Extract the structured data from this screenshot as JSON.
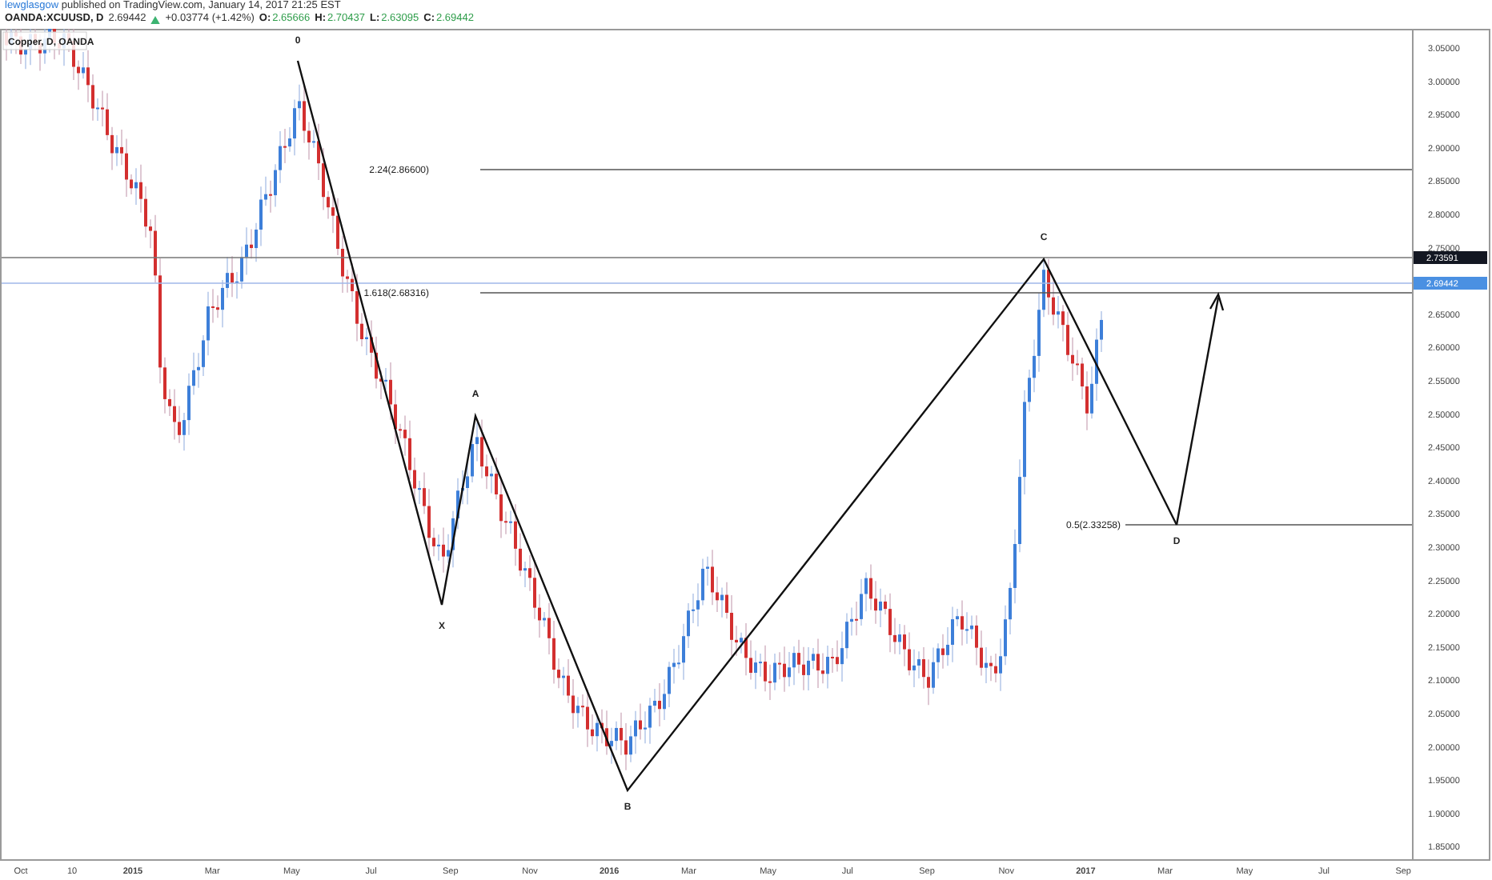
{
  "header": {
    "author": "lewglasgow",
    "published": "published on TradingView.com, January 14, 2017 21:25 EST",
    "symbol": "OANDA:XCUUSD, D",
    "price": "2.69442",
    "change": "+0.03774 (+1.42%)",
    "ohlc": [
      {
        "key": "O:",
        "value": "2.65666"
      },
      {
        "key": "H:",
        "value": "2.70437"
      },
      {
        "key": "L:",
        "value": "2.63095"
      },
      {
        "key": "C:",
        "value": "2.69442"
      }
    ]
  },
  "chart": {
    "legend": "Copper, D, OANDA",
    "price_ticks": [
      "3.05000",
      "3.00000",
      "2.95000",
      "2.90000",
      "2.85000",
      "2.80000",
      "2.75000",
      "2.65000",
      "2.60000",
      "2.55000",
      "2.50000",
      "2.45000",
      "2.40000",
      "2.35000",
      "2.30000",
      "2.25000",
      "2.20000",
      "2.15000",
      "2.10000",
      "2.05000",
      "2.00000",
      "1.95000",
      "1.90000",
      "1.85000"
    ],
    "time_ticks": [
      {
        "label": "Oct",
        "bold": false
      },
      {
        "label": "10",
        "bold": false
      },
      {
        "label": "2015",
        "bold": true
      },
      {
        "label": "Mar",
        "bold": false
      },
      {
        "label": "May",
        "bold": false
      },
      {
        "label": "Jul",
        "bold": false
      },
      {
        "label": "Sep",
        "bold": false
      },
      {
        "label": "Nov",
        "bold": false
      },
      {
        "label": "2016",
        "bold": true
      },
      {
        "label": "Mar",
        "bold": false
      },
      {
        "label": "May",
        "bold": false
      },
      {
        "label": "Jul",
        "bold": false
      },
      {
        "label": "Sep",
        "bold": false
      },
      {
        "label": "Nov",
        "bold": false
      },
      {
        "label": "2017",
        "bold": true
      },
      {
        "label": "Mar",
        "bold": false
      },
      {
        "label": "May",
        "bold": false
      },
      {
        "label": "Jul",
        "bold": false
      },
      {
        "label": "Sep",
        "bold": false
      }
    ],
    "price_markers": [
      {
        "label": "2.73591",
        "color": "#131722"
      },
      {
        "label": "2.69442",
        "color": "#4a90e2"
      }
    ],
    "pattern_points": [
      "0",
      "X",
      "A",
      "B",
      "C",
      "D"
    ],
    "fib_levels": [
      "2.24(2.86600)",
      "1.618(2.68316)",
      "0.5(2.33258)"
    ]
  }
}
